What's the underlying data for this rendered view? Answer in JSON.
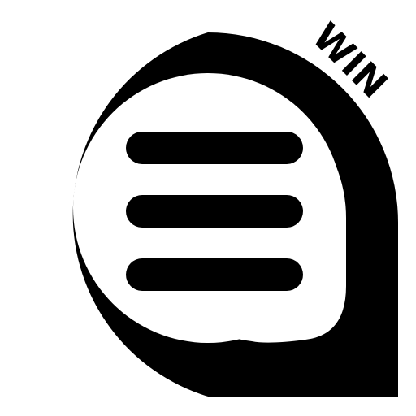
{
  "logo": {
    "badge_text": "WIN",
    "icon": "chat-bubble-menu-icon",
    "colors": {
      "foreground": "#000000",
      "background": "#ffffff"
    }
  }
}
